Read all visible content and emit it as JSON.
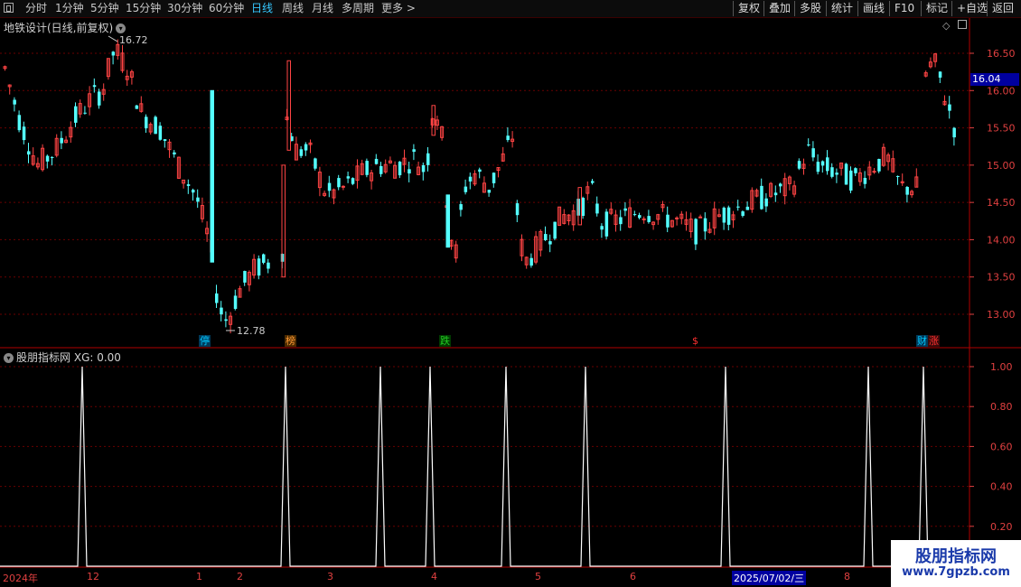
{
  "toolbar": {
    "periods": [
      "分时",
      "1分钟",
      "5分钟",
      "15分钟",
      "30分钟",
      "60分钟",
      "日线",
      "周线",
      "月线",
      "多周期",
      "更多"
    ],
    "active_period": "日线",
    "more_arrow": ">",
    "right_buttons": [
      "复权",
      "叠加",
      "多股",
      "统计",
      "画线",
      "F10",
      "标记",
      "+自选",
      "返回"
    ]
  },
  "main_panel": {
    "title": "地铁设计(日线,前复权)",
    "high_marker": "16.72",
    "low_marker": "12.78",
    "current_price": "16.04",
    "y_ticks": [
      "16.50",
      "16.00",
      "15.50",
      "15.00",
      "14.50",
      "14.00",
      "13.50",
      "13.00"
    ],
    "badges": [
      {
        "text": "停",
        "color": "#00c8ff"
      },
      {
        "text": "榜",
        "color": "#ff9933"
      },
      {
        "text": "跌",
        "color": "#22cc22"
      },
      {
        "text": "$",
        "color": "#ff3030"
      },
      {
        "text": "财",
        "color": "#00c8ff"
      },
      {
        "text": "涨",
        "color": "#ff3030"
      }
    ]
  },
  "indicator_panel": {
    "title": "股朋指标网",
    "value_label": "XG: 0.00",
    "y_ticks": [
      "1.00",
      "0.80",
      "0.60",
      "0.40",
      "0.20"
    ]
  },
  "date_axis": {
    "labels": [
      "2024年",
      "12",
      "1",
      "2",
      "3",
      "4",
      "5",
      "6",
      "2025/07/02/三",
      "8"
    ]
  },
  "watermark": {
    "line1": "股朋指标网",
    "line2": "www.7gpzb.com"
  },
  "colors": {
    "up": "#ff4444",
    "down": "#54ffff",
    "grid": "#6a0000",
    "axis": "#e04040",
    "signal": "#ffffff"
  }
}
